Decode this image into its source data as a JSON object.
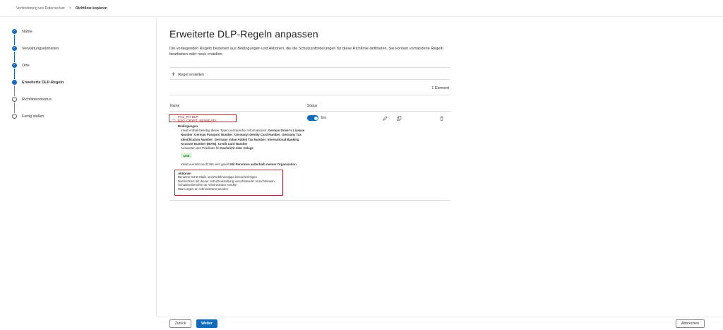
{
  "breadcrumb": {
    "parent": "Verhinderung von Datenverlust",
    "separator": ">",
    "current": "Richtlinie kopieren"
  },
  "steps": [
    {
      "label": "Name",
      "state": "done"
    },
    {
      "label": "Verwaltungseinheiten",
      "state": "done"
    },
    {
      "label": "Orte",
      "state": "done"
    },
    {
      "label": "Erweiterte DLP-Regeln",
      "state": "current"
    },
    {
      "label": "Richtlinienmodus",
      "state": "todo"
    },
    {
      "label": "Fertig stellen",
      "state": "todo"
    }
  ],
  "page": {
    "title": "Erweiterte DLP-Regeln anpassen",
    "description": "Die vorliegenden Regeln bestehen aus Bedingungen und Aktionen, die die Schutzanforderungen für diese Richtlinie definieren. Sie können vorhandene Regeln bearbeiten oder neue erstellen.",
    "add_rule": "Regel erstellen",
    "count": "1 Element"
  },
  "table": {
    "col_name": "Name",
    "col_status": "Status"
  },
  "rule": {
    "name": "POL_PH-DLP-EXO_CRYPT_SENSDATA",
    "status_label": "Ein",
    "conditions_label": "Bedingungen",
    "conditions_intro": "Inhalt enthält beliebig dieser Typen vertraulicher Informationen:",
    "sit_1": "German Driver's License Number",
    "sit_2": "German Passport Number",
    "sit_3": "Germany Identity Card Number",
    "sit_4": "Germany Tax Identification Number",
    "sit_5": "Germany Value Added Tax Number",
    "sit_6": "International Banking Account Number (IBAN)",
    "sit_7": "Credit Card Number",
    "predicate_intro": "Auswerten des Prädikats für",
    "predicate_value": "Nachricht oder Anlage",
    "und": "Und",
    "shared_intro": "Inhalt aus Microsoft 365 wird geteilt",
    "shared_value": "Mit Personen außerhalb meiner Organisation",
    "actions_label": "Aktionen",
    "actions": [
      "Benutzer mit E-Mails und Richtlinientipps benachrichtigen",
      "Nachrichten mit dieser Schutzeinstellung verschlüsseln: Verschlüsseln",
      "Schadensberichte an Administrator senden",
      "Warnungen an Administrator senden"
    ]
  },
  "footer": {
    "back": "Zurück",
    "next": "Weiter",
    "cancel": "Abbrechen"
  },
  "colors": {
    "accent": "#0f6cbd",
    "highlight_box": "#a4262c",
    "und_badge_bg": "#dff6dd"
  }
}
